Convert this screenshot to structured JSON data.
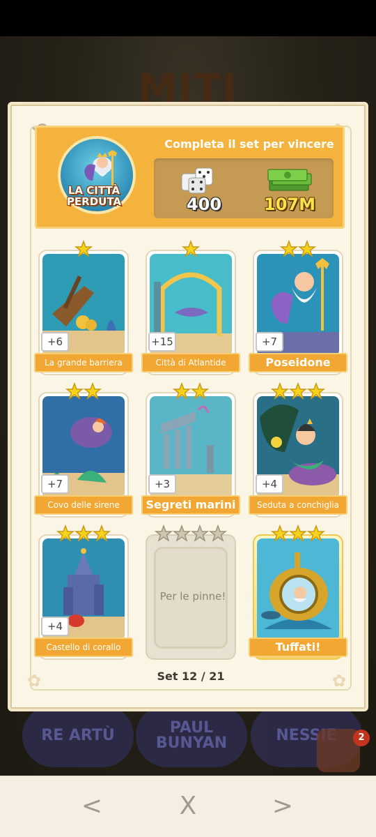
{
  "background": {
    "title_text": "MITI",
    "badges": [
      "RE ARTÙ",
      "PAUL BUNYAN",
      "NESSIE"
    ],
    "notification_count": "2"
  },
  "header": {
    "set_name_line1": "LA CITTÀ",
    "set_name_line2": "PERDUTA",
    "caption": "Completa il set per vincere",
    "reward_dice": "400",
    "reward_cash": "107M"
  },
  "cards": [
    {
      "name": "La grande barriera",
      "qty": "+6",
      "stars": 1,
      "state": "owned",
      "scene": "shipwreck"
    },
    {
      "name": "Città di Atlantide",
      "qty": "+15",
      "stars": 1,
      "state": "owned",
      "scene": "gate"
    },
    {
      "name": "Poseidone",
      "qty": "+7",
      "stars": 2,
      "state": "owned",
      "scene": "poseidon"
    },
    {
      "name": "Covo delle sirene",
      "qty": "+7",
      "stars": 2,
      "state": "owned",
      "scene": "cove"
    },
    {
      "name": "Segreti marini",
      "qty": "+3",
      "stars": 2,
      "state": "owned",
      "scene": "ruins"
    },
    {
      "name": "Seduta a conchiglia",
      "qty": "+4",
      "stars": 3,
      "state": "owned",
      "scene": "mermaid"
    },
    {
      "name": "Castello di corallo",
      "qty": "+4",
      "stars": 3,
      "state": "owned",
      "scene": "castle"
    },
    {
      "name": "Per le pinne!",
      "qty": "",
      "stars": 4,
      "state": "locked",
      "scene": "none"
    },
    {
      "name": "Tuffati!",
      "qty": "",
      "stars": 3,
      "state": "gold",
      "scene": "submarine"
    }
  ],
  "footer": {
    "set_counter": "Set 12 / 21"
  },
  "navbar": {
    "prev": "<",
    "close": "X",
    "next": ">"
  },
  "colors": {
    "accent": "#f2a732",
    "header_bg": "#f3b33d",
    "panel_bg": "#fbf5e6",
    "star": "#f7d21c"
  }
}
